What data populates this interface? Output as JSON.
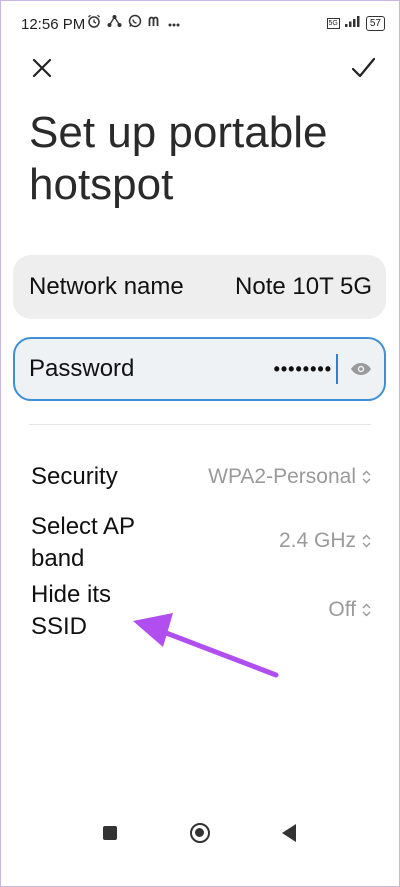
{
  "status": {
    "time": "12:56 PM",
    "network_badge": "5G",
    "battery": "57"
  },
  "page": {
    "title": "Set up portable hotspot"
  },
  "fields": {
    "network_name_label": "Network name",
    "network_name_value": "Note 10T 5G",
    "password_label": "Password",
    "password_masked": "••••••••"
  },
  "settings": [
    {
      "label": "Security",
      "value": "WPA2-Personal"
    },
    {
      "label": "Select AP band",
      "value": "2.4 GHz"
    },
    {
      "label": "Hide its SSID",
      "value": "Off"
    }
  ],
  "colors": {
    "accent": "#3d8fd6",
    "arrow": "#b04ef0"
  }
}
